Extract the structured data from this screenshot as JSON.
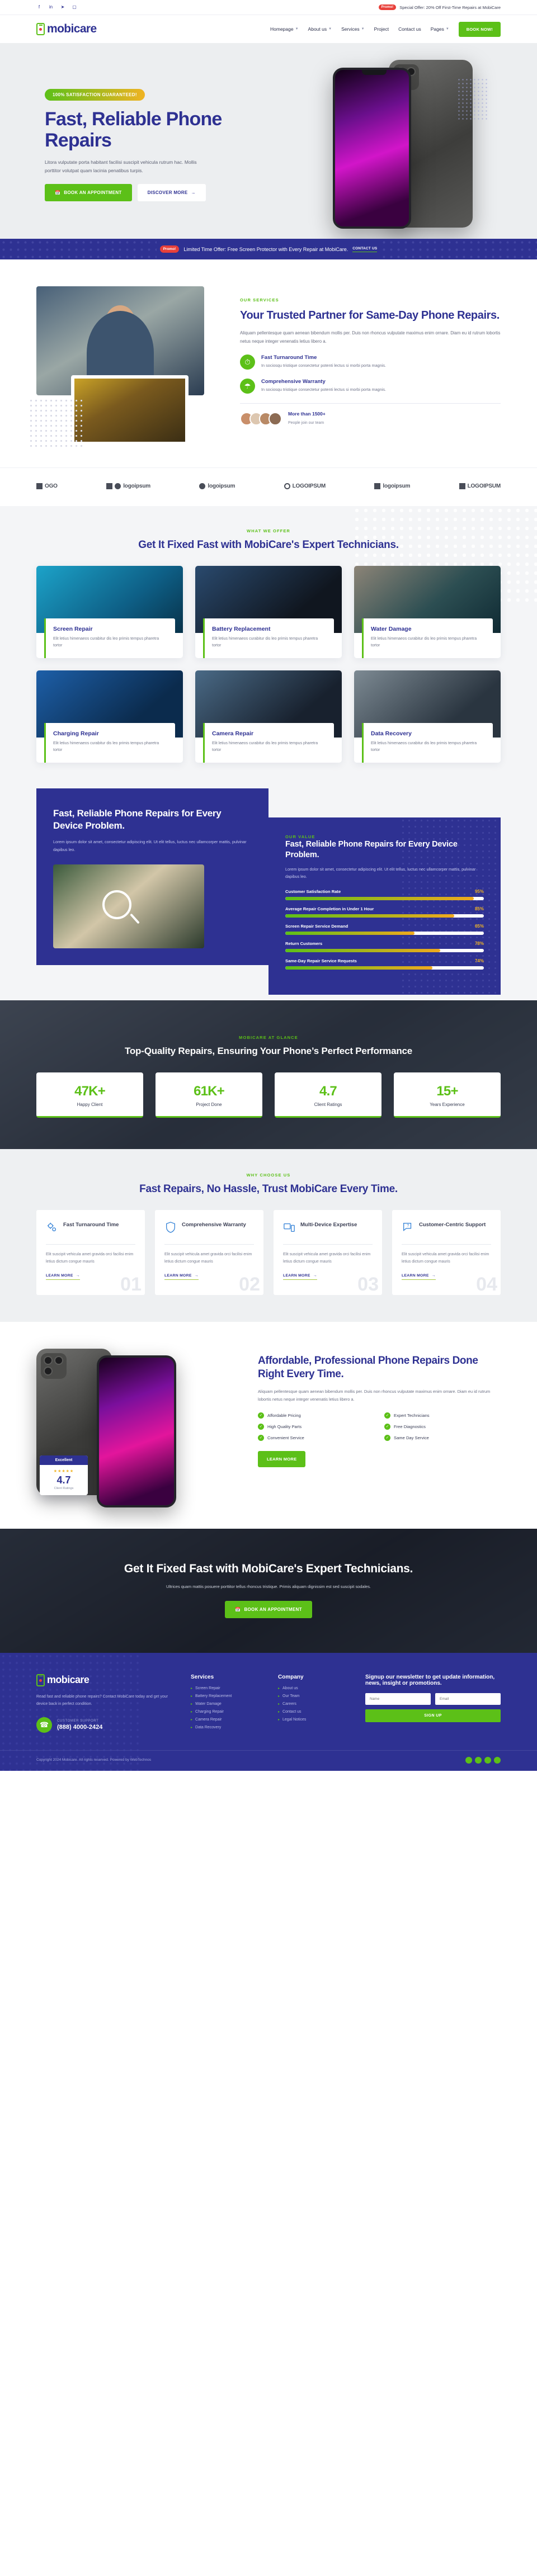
{
  "topbar": {
    "socials": [
      "facebook-icon",
      "linkedin-icon",
      "twitter-icon",
      "instagram-icon"
    ],
    "social_glyphs": [
      "f",
      "in",
      "✈",
      "□"
    ],
    "promo_tag": "Promo!",
    "offer_text": "Special Offer: 20% Off First-Time Repairs at MobiCare"
  },
  "header": {
    "logo_text": "mobicare",
    "nav": [
      {
        "label": "Homepage",
        "has_caret": true
      },
      {
        "label": "About us",
        "has_caret": true
      },
      {
        "label": "Services",
        "has_caret": true
      },
      {
        "label": "Project",
        "has_caret": false
      },
      {
        "label": "Contact us",
        "has_caret": false
      },
      {
        "label": "Pages",
        "has_caret": true
      }
    ],
    "book_button": "BOOK NOW!"
  },
  "hero": {
    "badge": "100% SATISFACTION GUARANTEED!",
    "title": "Fast, Reliable Phone Repairs",
    "paragraph": "Litora vulputate porta habitant facilisi suscipit vehicula rutrum hac. Mollis porttitor volutpat quam lacinia penatibus turpis.",
    "primary_button": "BOOK AN APPOINTMENT",
    "secondary_button": "DISCOVER MORE"
  },
  "promo_strip": {
    "tag": "Promo!",
    "text": "Limited Time Offer: Free Screen Protector with Every Repair at MobiCare.",
    "cta": "CONTACT US"
  },
  "about": {
    "eyebrow": "OUR SERVICES",
    "title": "Your Trusted Partner for Same-Day Phone Repairs.",
    "lead": "Aliquam pellentesque quam aenean bibendum mollis per. Duis non rhoncus vulputate maximus enim ornare. Diam eu id rutrum lobortis netus neque integer venenatis letius libero a.",
    "features": [
      {
        "icon": "speedometer-icon",
        "title": "Fast Turnaround Time",
        "text": "In sociosqu tristique consectetur potenti lectus si morbi porta magnis."
      },
      {
        "icon": "umbrella-icon",
        "title": "Comprehensive Warranty",
        "text": "In sociosqu tristique consectetur potenti lectus si morbi porta magnis."
      }
    ],
    "team_count": "More than 1500+",
    "team_label": "People join our team"
  },
  "logos": [
    {
      "name": "logo-brand-1",
      "text": "OGO"
    },
    {
      "name": "logo-brand-2",
      "text": "logoipsum"
    },
    {
      "name": "logo-brand-3",
      "text": "logoipsum"
    },
    {
      "name": "logo-brand-4",
      "text": "LOGOIPSUM"
    },
    {
      "name": "logo-brand-5",
      "text": "logoipsum"
    },
    {
      "name": "logo-brand-6",
      "text": "LOGOIPSUM"
    }
  ],
  "services": {
    "eyebrow": "WHAT WE OFFER",
    "title": "Get It Fixed Fast with MobiCare's Expert Technicians.",
    "cards": [
      {
        "title": "Screen Repair",
        "text": "Elit letius himenaeos curabitur dis leo primis tempus pharetra tortor"
      },
      {
        "title": "Battery Replacement",
        "text": "Elit letius himenaeos curabitur dis leo primis tempus pharetra tortor"
      },
      {
        "title": "Water Damage",
        "text": "Elit letius himenaeos curabitur dis leo primis tempus pharetra tortor"
      },
      {
        "title": "Charging Repair",
        "text": "Elit letius himenaeos curabitur dis leo primis tempus pharetra tortor"
      },
      {
        "title": "Camera Repair",
        "text": "Elit letius himenaeos curabitur dis leo primis tempus pharetra tortor"
      },
      {
        "title": "Data Recovery",
        "text": "Elit letius himenaeos curabitur dis leo primis tempus pharetra tortor"
      }
    ]
  },
  "value": {
    "left_title": "Fast, Reliable Phone Repairs for Every Device Problem.",
    "left_text": "Lorem ipsum dolor sit amet, consectetur adipiscing elit. Ut elit tellus, luctus nec ullamcorper mattis, pulvinar dapibus leo.",
    "eyebrow": "OUR VALUE",
    "right_title": "Fast, Reliable Phone Repairs for Every Device Problem.",
    "right_text": "Lorem ipsum dolor sit amet, consectetur adipiscing elit. Ut elit tellus, luctus nec ullamcorper mattis, pulvinar dapibus leo.",
    "bars": [
      {
        "label": "Customer Satisfaction Rate",
        "pct": "95%",
        "value": 95
      },
      {
        "label": "Average Repair Completion in Under 1 Hour",
        "pct": "85%",
        "value": 85
      },
      {
        "label": "Screen Repair Service Demand",
        "pct": "65%",
        "value": 65
      },
      {
        "label": "Return Customers",
        "pct": "78%",
        "value": 78
      },
      {
        "label": "Same-Day Repair Service Requests",
        "pct": "74%",
        "value": 74
      }
    ]
  },
  "glance": {
    "eyebrow": "MOBICARE AT GLANCE",
    "title": "Top-Quality Repairs, Ensuring Your Phone’s Perfect Performance",
    "stats": [
      {
        "num": "47K+",
        "label": "Happy Client"
      },
      {
        "num": "61K+",
        "label": "Project Done"
      },
      {
        "num": "4.7",
        "label": "Client Ratings"
      },
      {
        "num": "15+",
        "label": "Years Experience"
      }
    ]
  },
  "why": {
    "eyebrow": "WHY CHOOSE US",
    "title": "Fast Repairs, No Hassle, Trust MobiCare Every Time.",
    "cards": [
      {
        "icon": "gears-icon",
        "title": "Fast Turnaround Time",
        "text": "Elit suscipit vehicula amet gravida orci facilisi enim letius dictum congue mauris",
        "learn": "LEARN MORE",
        "num": "01"
      },
      {
        "icon": "shield-icon",
        "title": "Comprehensive Warranty",
        "text": "Elit suscipit vehicula amet gravida orci facilisi enim letius dictum congue mauris",
        "learn": "LEARN MORE",
        "num": "02"
      },
      {
        "icon": "devices-icon",
        "title": "Multi-Device Expertise",
        "text": "Elit suscipit vehicula amet gravida orci facilisi enim letius dictum congue mauris",
        "learn": "LEARN MORE",
        "num": "03"
      },
      {
        "icon": "support-chat-icon",
        "title": "Customer-Centric Support",
        "text": "Elit suscipit vehicula amet gravida orci facilisi enim letius dictum congue mauris",
        "learn": "LEARN MORE",
        "num": "04"
      }
    ]
  },
  "afford": {
    "title": "Affordable, Professional Phone Repairs Done Right Every Time.",
    "text": "Aliquam pellentesque quam aenean bibendum mollis per. Duis non rhoncus vulputate maximus enim ornare. Diam eu id rutrum lobortis netus neque integer venenatis letius libero a.",
    "checks": [
      "Affordable Pricing",
      "Expert Technicians",
      "High Quality Parts",
      "Free Diagnostics",
      "Convenient Service",
      "Same Day Service"
    ],
    "button": "LEARN MORE",
    "rating_badge": "Excellent",
    "rating_stars": "★★★★★",
    "rating_value": "4.7",
    "rating_sub": "Client Ratings"
  },
  "cta": {
    "title": "Get It Fixed Fast with MobiCare's Expert Technicians.",
    "text": "Ultrices quam mattis posuere porttitor tellus rhoncus tristique. Primis aliquam dignissim est sed suscipit sodales.",
    "button": "BOOK AN APPOINTMENT"
  },
  "footer": {
    "logo_text": "mobicare",
    "about": "Read fast and reliable phone repairs? Contact MobiCare today and get your device back in perfect condition.",
    "support_label": "CUSTOMER SUPPORT",
    "support_phone": "(888) 4000-2424",
    "services": {
      "title": "Services",
      "items": [
        "Screen Repair",
        "Battery Replacement",
        "Water Damage",
        "Charging Repair",
        "Camera Repair",
        "Data Recovery"
      ]
    },
    "company": {
      "title": "Company",
      "items": [
        "About us",
        "Our Team",
        "Careers",
        "Contact us",
        "Legal Notices"
      ]
    },
    "newsletter": {
      "title": "Signup our newsletter to get update information, news, insight or promotions.",
      "name_placeholder": "Name",
      "email_placeholder": "Email",
      "button": "SIGN UP"
    },
    "copyright": "Copyright 2024 Mobicare. All rights reserved. Powered by WebTechnos"
  },
  "colors": {
    "brand_blue": "#2e3192",
    "brand_green": "#5cc018",
    "accent_orange": "#f0b323",
    "accent_red": "#e8403a"
  }
}
